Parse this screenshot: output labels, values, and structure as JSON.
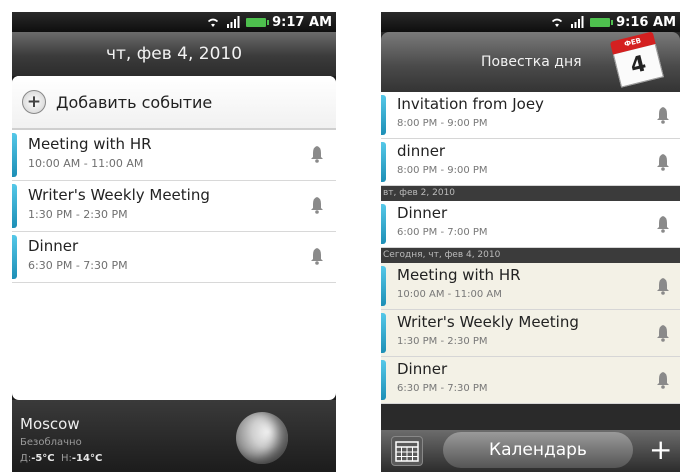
{
  "left": {
    "status_time": "9:17 AM",
    "date": "чт, фев 4, 2010",
    "add_event": "Добавить событие",
    "events": [
      {
        "title": "Meeting with HR",
        "time": "10:00 AM - 11:00 AM"
      },
      {
        "title": "Writer's Weekly Meeting",
        "time": "1:30 PM - 2:30 PM"
      },
      {
        "title": "Dinner",
        "time": "6:30 PM - 7:30 PM"
      }
    ],
    "weather": {
      "city": "Moscow",
      "condition": "Безоблачно",
      "low_label": "Д:",
      "low": "-5°C",
      "high_label": "Н:",
      "high": "-14°C"
    }
  },
  "right": {
    "status_time": "9:16 AM",
    "title": "Повестка дня",
    "calendar_icon_day": "4",
    "calendar_icon_month": "ФЕВ",
    "group1": [
      {
        "title": "Invitation from Joey",
        "time": "8:00 PM - 9:00 PM"
      },
      {
        "title": "dinner",
        "time": "8:00 PM - 9:00 PM"
      }
    ],
    "sep1": "вт, фев 2, 2010",
    "group2": [
      {
        "title": "Dinner",
        "time": "6:00 PM - 7:00 PM"
      }
    ],
    "sep2": "Сегодня, чт, фев 4, 2010",
    "group3": [
      {
        "title": "Meeting with HR",
        "time": "10:00 AM - 11:00 AM"
      },
      {
        "title": "Writer's Weekly Meeting",
        "time": "1:30 PM - 2:30 PM"
      },
      {
        "title": "Dinner",
        "time": "6:30 PM - 7:30 PM"
      }
    ],
    "bottom_tab": "Календарь",
    "plus": "+"
  },
  "colors": {
    "event_bar": "#2aa6d2",
    "battery": "#4ec04e",
    "calendar_red": "#d42020"
  }
}
